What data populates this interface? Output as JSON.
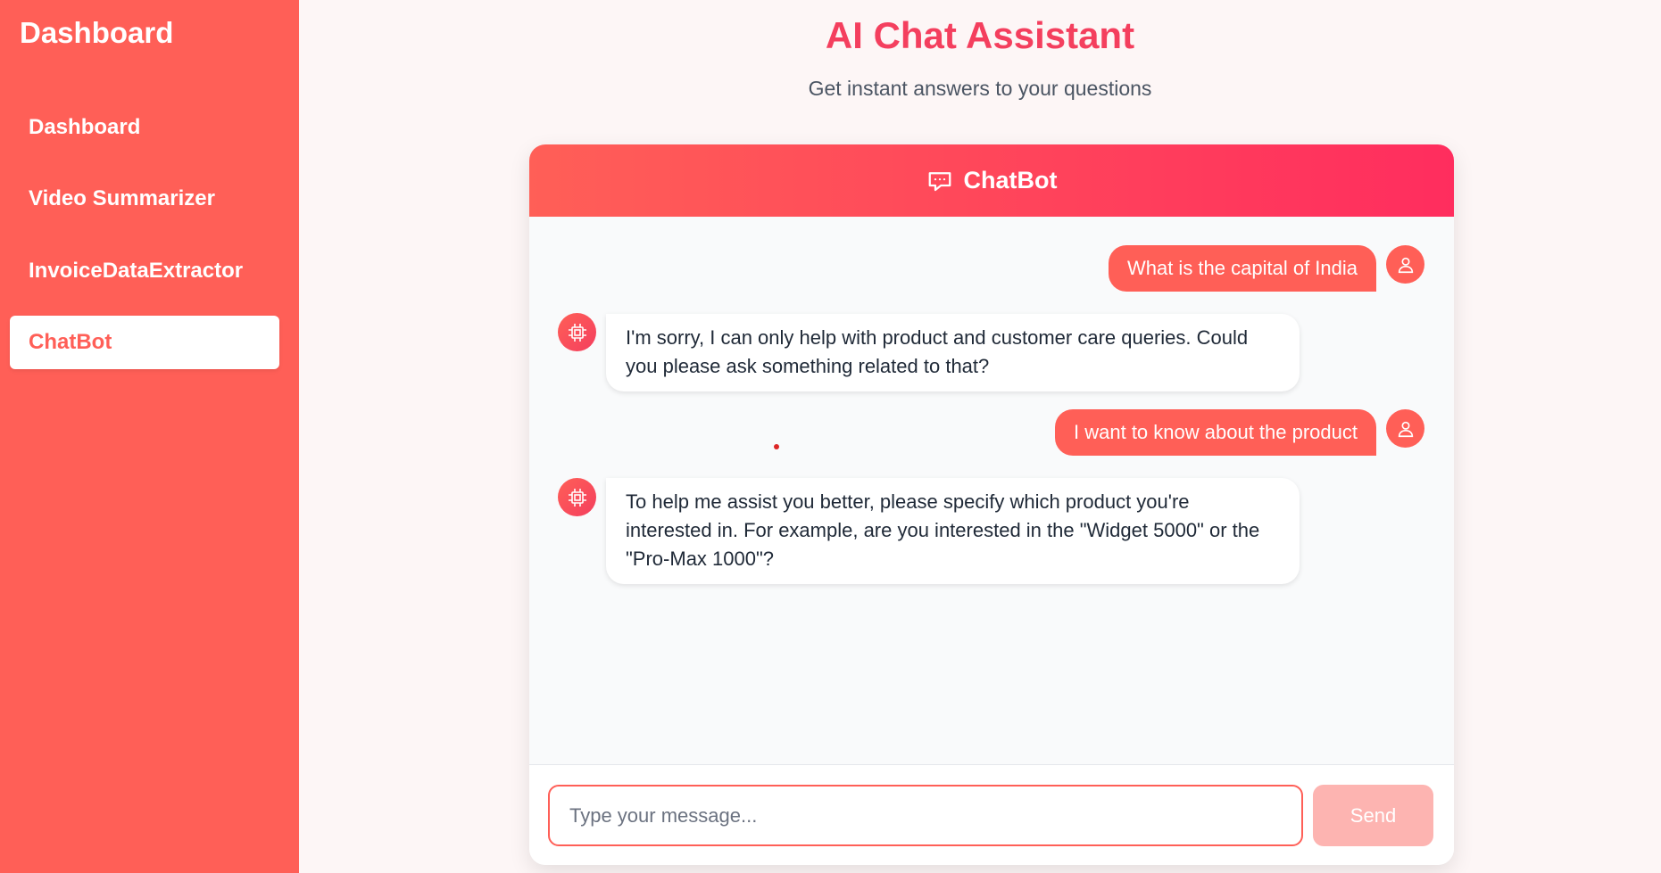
{
  "sidebar": {
    "title": "Dashboard",
    "items": [
      {
        "label": "Dashboard",
        "active": false
      },
      {
        "label": "Video Summarizer",
        "active": false
      },
      {
        "label": "InvoiceDataExtractor",
        "active": false
      },
      {
        "label": "ChatBot",
        "active": true
      }
    ]
  },
  "header": {
    "title": "AI Chat Assistant",
    "subtitle": "Get instant answers to your questions"
  },
  "chat": {
    "title": "ChatBot",
    "header_icon": "chat-bubble-icon",
    "messages": [
      {
        "sender": "user",
        "text": "What is the capital of India",
        "avatar_icon": "user-icon"
      },
      {
        "sender": "bot",
        "text": "I'm sorry, I can only help with product and customer care queries. Could you please ask something related to that?",
        "avatar_icon": "chip-icon"
      },
      {
        "sender": "user",
        "text": "I want to know about the product",
        "avatar_icon": "user-icon"
      },
      {
        "sender": "bot",
        "text": "To help me assist you better, please specify which product you're interested in. For example, are you interested in the \"Widget 5000\" or the \"Pro-Max 1000\"?",
        "avatar_icon": "chip-icon"
      }
    ],
    "input": {
      "value": "",
      "placeholder": "Type your message..."
    },
    "send_label": "Send"
  },
  "colors": {
    "accent": "#ff5f57",
    "title": "#f43f5e",
    "send_disabled": "#fdb4b1"
  }
}
